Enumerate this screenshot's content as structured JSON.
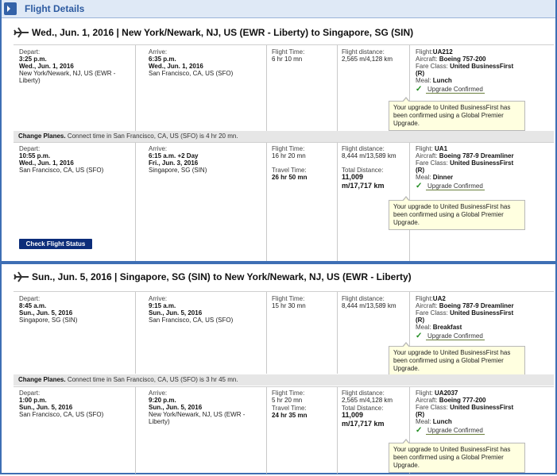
{
  "panel_title": "Flight Details",
  "trips": [
    {
      "header": "Wed., Jun. 1, 2016 | New York/Newark, NJ, US (EWR - Liberty) to Singapore, SG (SIN)",
      "segments": [
        {
          "depart": {
            "label": "Depart:",
            "time": "3:25 p.m.",
            "date": "Wed., Jun. 1, 2016",
            "place1": "New York/Newark, NJ, US (EWR -",
            "place2": "Liberty)"
          },
          "arrive": {
            "label": "Arrive:",
            "time": "6:35 p.m.",
            "date": "Wed., Jun. 1, 2016",
            "place1": "San Francisco, CA, US (SFO)",
            "place2": ""
          },
          "flight_time": {
            "label": "Flight Time:",
            "value": "6 hr 10 mn"
          },
          "distance": {
            "label": "Flight distance:",
            "value": "2,565 m/4,128 km"
          },
          "details": {
            "flight_label": "Flight:",
            "flight": "UA212",
            "aircraft_label": "Aircraft:",
            "aircraft": "Boeing 757-200",
            "fare_label": "Fare Class:",
            "fare": "United BusinessFirst",
            "fare2": "(R)",
            "meal_label": "Meal:",
            "meal": "Lunch",
            "upgrade": "Upgrade Confirmed"
          },
          "confirmation": "Your upgrade to United BusinessFirst has been confirmed using a Global Premier Upgrade."
        },
        {
          "depart": {
            "label": "Depart:",
            "time": "10:55 p.m.",
            "date": "Wed., Jun. 1, 2016",
            "place1": "San Francisco, CA, US (SFO)",
            "place2": ""
          },
          "arrive": {
            "label": "Arrive:",
            "time": "6:15 a.m. +2 Day",
            "date": "Fri., Jun. 3, 2016",
            "place1": "Singapore, SG (SIN)",
            "place2": ""
          },
          "flight_time": {
            "label": "Flight Time:",
            "value": "16 hr 20 mn"
          },
          "travel_time": {
            "label": "Travel Time:",
            "value": "26 hr 50 mn"
          },
          "distance": {
            "label": "Flight distance:",
            "value": "8,444 m/13,589 km"
          },
          "total_distance": {
            "label": "Total Distance:",
            "value1": "11,009",
            "value2": "m/17,717 km"
          },
          "details": {
            "flight_label": "Flight:",
            "flight": "UA1",
            "aircraft_label": "Aircraft:",
            "aircraft": "Boeing 787-9 Dreamliner",
            "fare_label": "Fare Class:",
            "fare": "United BusinessFirst",
            "fare2": "(R)",
            "meal_label": "Meal:",
            "meal": "Dinner",
            "upgrade": "Upgrade Confirmed"
          },
          "confirmation": "Your upgrade to United BusinessFirst has been confirmed using a Global Premier Upgrade."
        }
      ],
      "change_planes": {
        "label": "Change Planes.",
        "text": "Connect time in San Francisco, CA, US (SFO) is 4 hr 20 mn."
      },
      "check_status": "Check Flight Status"
    },
    {
      "header": "Sun., Jun. 5, 2016 | Singapore, SG (SIN) to New York/Newark, NJ, US (EWR - Liberty)",
      "segments": [
        {
          "depart": {
            "label": "Depart:",
            "time": "8:45 a.m.",
            "date": "Sun., Jun. 5, 2016",
            "place1": "Singapore, SG (SIN)",
            "place2": ""
          },
          "arrive": {
            "label": "Arrive:",
            "time": "9:15 a.m.",
            "date": "Sun., Jun. 5, 2016",
            "place1": "San Francisco, CA, US (SFO)",
            "place2": ""
          },
          "flight_time": {
            "label": "Flight Time:",
            "value": "15 hr 30 mn"
          },
          "distance": {
            "label": "Flight distance:",
            "value": "8,444 m/13,589 km"
          },
          "details": {
            "flight_label": "Flight:",
            "flight": "UA2",
            "aircraft_label": "Aircraft:",
            "aircraft": "Boeing 787-9 Dreamliner",
            "fare_label": "Fare Class:",
            "fare": "United BusinessFirst",
            "fare2": "(R)",
            "meal_label": "Meal:",
            "meal": "Breakfast",
            "upgrade": "Upgrade Confirmed"
          },
          "confirmation": "Your upgrade to United BusinessFirst has been confirmed using a Global Premier Upgrade."
        },
        {
          "depart": {
            "label": "Depart:",
            "time": "1:00 p.m.",
            "date": "Sun., Jun. 5, 2016",
            "place1": "San Francisco, CA, US (SFO)",
            "place2": ""
          },
          "arrive": {
            "label": "Arrive:",
            "time": "9:20 p.m.",
            "date": "Sun., Jun. 5, 2016",
            "place1": "New York/Newark, NJ, US (EWR -",
            "place2": "Liberty)"
          },
          "flight_time": {
            "label": "Flight Time:",
            "value": "5 hr 20 mn"
          },
          "travel_time": {
            "label": "Travel Time:",
            "value": "24 hr 35 mn"
          },
          "distance": {
            "label": "Flight distance:",
            "value": "2,565 m/4,128 km"
          },
          "total_distance": {
            "label": "Total Distance:",
            "value1": "11,009",
            "value2": "m/17,717 km"
          },
          "details": {
            "flight_label": "Flight:",
            "flight": "UA2037",
            "aircraft_label": "Aircraft:",
            "aircraft": "Boeing 777-200",
            "fare_label": "Fare Class:",
            "fare": "United BusinessFirst",
            "fare2": "(R)",
            "meal_label": "Meal:",
            "meal": "Lunch",
            "upgrade": "Upgrade Confirmed"
          },
          "confirmation": "Your upgrade to United BusinessFirst has been confirmed using a Global Premier Upgrade."
        }
      ],
      "change_planes": {
        "label": "Change Planes.",
        "text": "Connect time in San Francisco, CA, US (SFO) is 3 hr 45 mn."
      }
    }
  ],
  "colors": {
    "accent": "#3e6fb4",
    "header_bg": "#dfe9f6",
    "button": "#0c2d7a",
    "confirm_bg": "#ffffe0",
    "check": "#1f8b1f"
  }
}
